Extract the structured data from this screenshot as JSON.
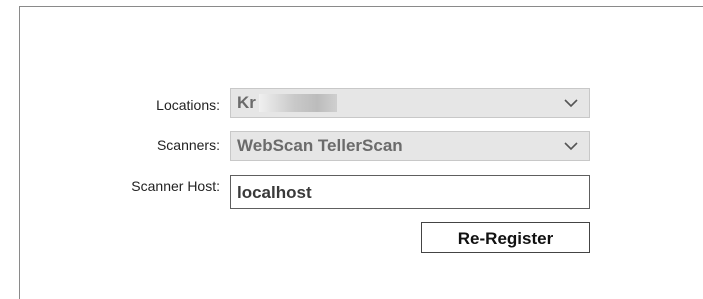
{
  "form": {
    "locations": {
      "label": "Locations:",
      "value": "Kr"
    },
    "scanners": {
      "label": "Scanners:",
      "value": "WebScan TellerScan"
    },
    "scanner_host": {
      "label": "Scanner Host:",
      "value": "localhost"
    },
    "reregister_label": "Re-Register"
  },
  "icons": {
    "dropdown": "chevron-down-icon"
  },
  "colors": {
    "select_bg": "#e6e6e6",
    "select_text": "#6b6b6b",
    "border": "#5e5e5e"
  }
}
